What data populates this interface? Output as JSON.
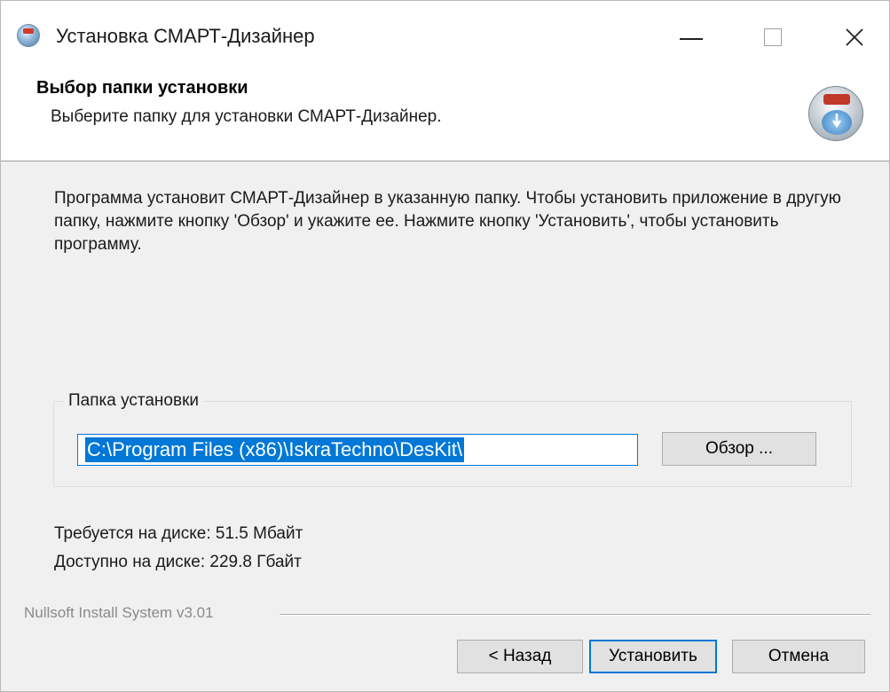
{
  "window": {
    "title": "Установка СМАРТ-Дизайнер",
    "icon": "installer-globe-icon"
  },
  "header": {
    "title": "Выбор папки установки",
    "subtitle": "Выберите папку для установки СМАРТ-Дизайнер.",
    "icon": "nsis-installer-icon"
  },
  "body": {
    "description": "Программа установит СМАРТ-Дизайнер в указанную папку. Чтобы установить приложение в другую папку, нажмите кнопку 'Обзор' и укажите ее. Нажмите кнопку 'Установить', чтобы установить программу.",
    "group_label": "Папка установки",
    "install_path": "C:\\Program Files (x86)\\IskraTechno\\DesKit\\",
    "browse_label": "Обзор ...",
    "space_required": "Требуется на диске: 51.5 Мбайт",
    "space_available": "Доступно на диске: 229.8 Гбайт"
  },
  "footer": {
    "branding": "Nullsoft Install System v3.01",
    "back_label": "< Назад",
    "install_label": "Установить",
    "cancel_label": "Отмена"
  },
  "colors": {
    "accent": "#0078d7",
    "dialog_bg": "#f0f0f0",
    "button_bg": "#e1e1e1"
  }
}
